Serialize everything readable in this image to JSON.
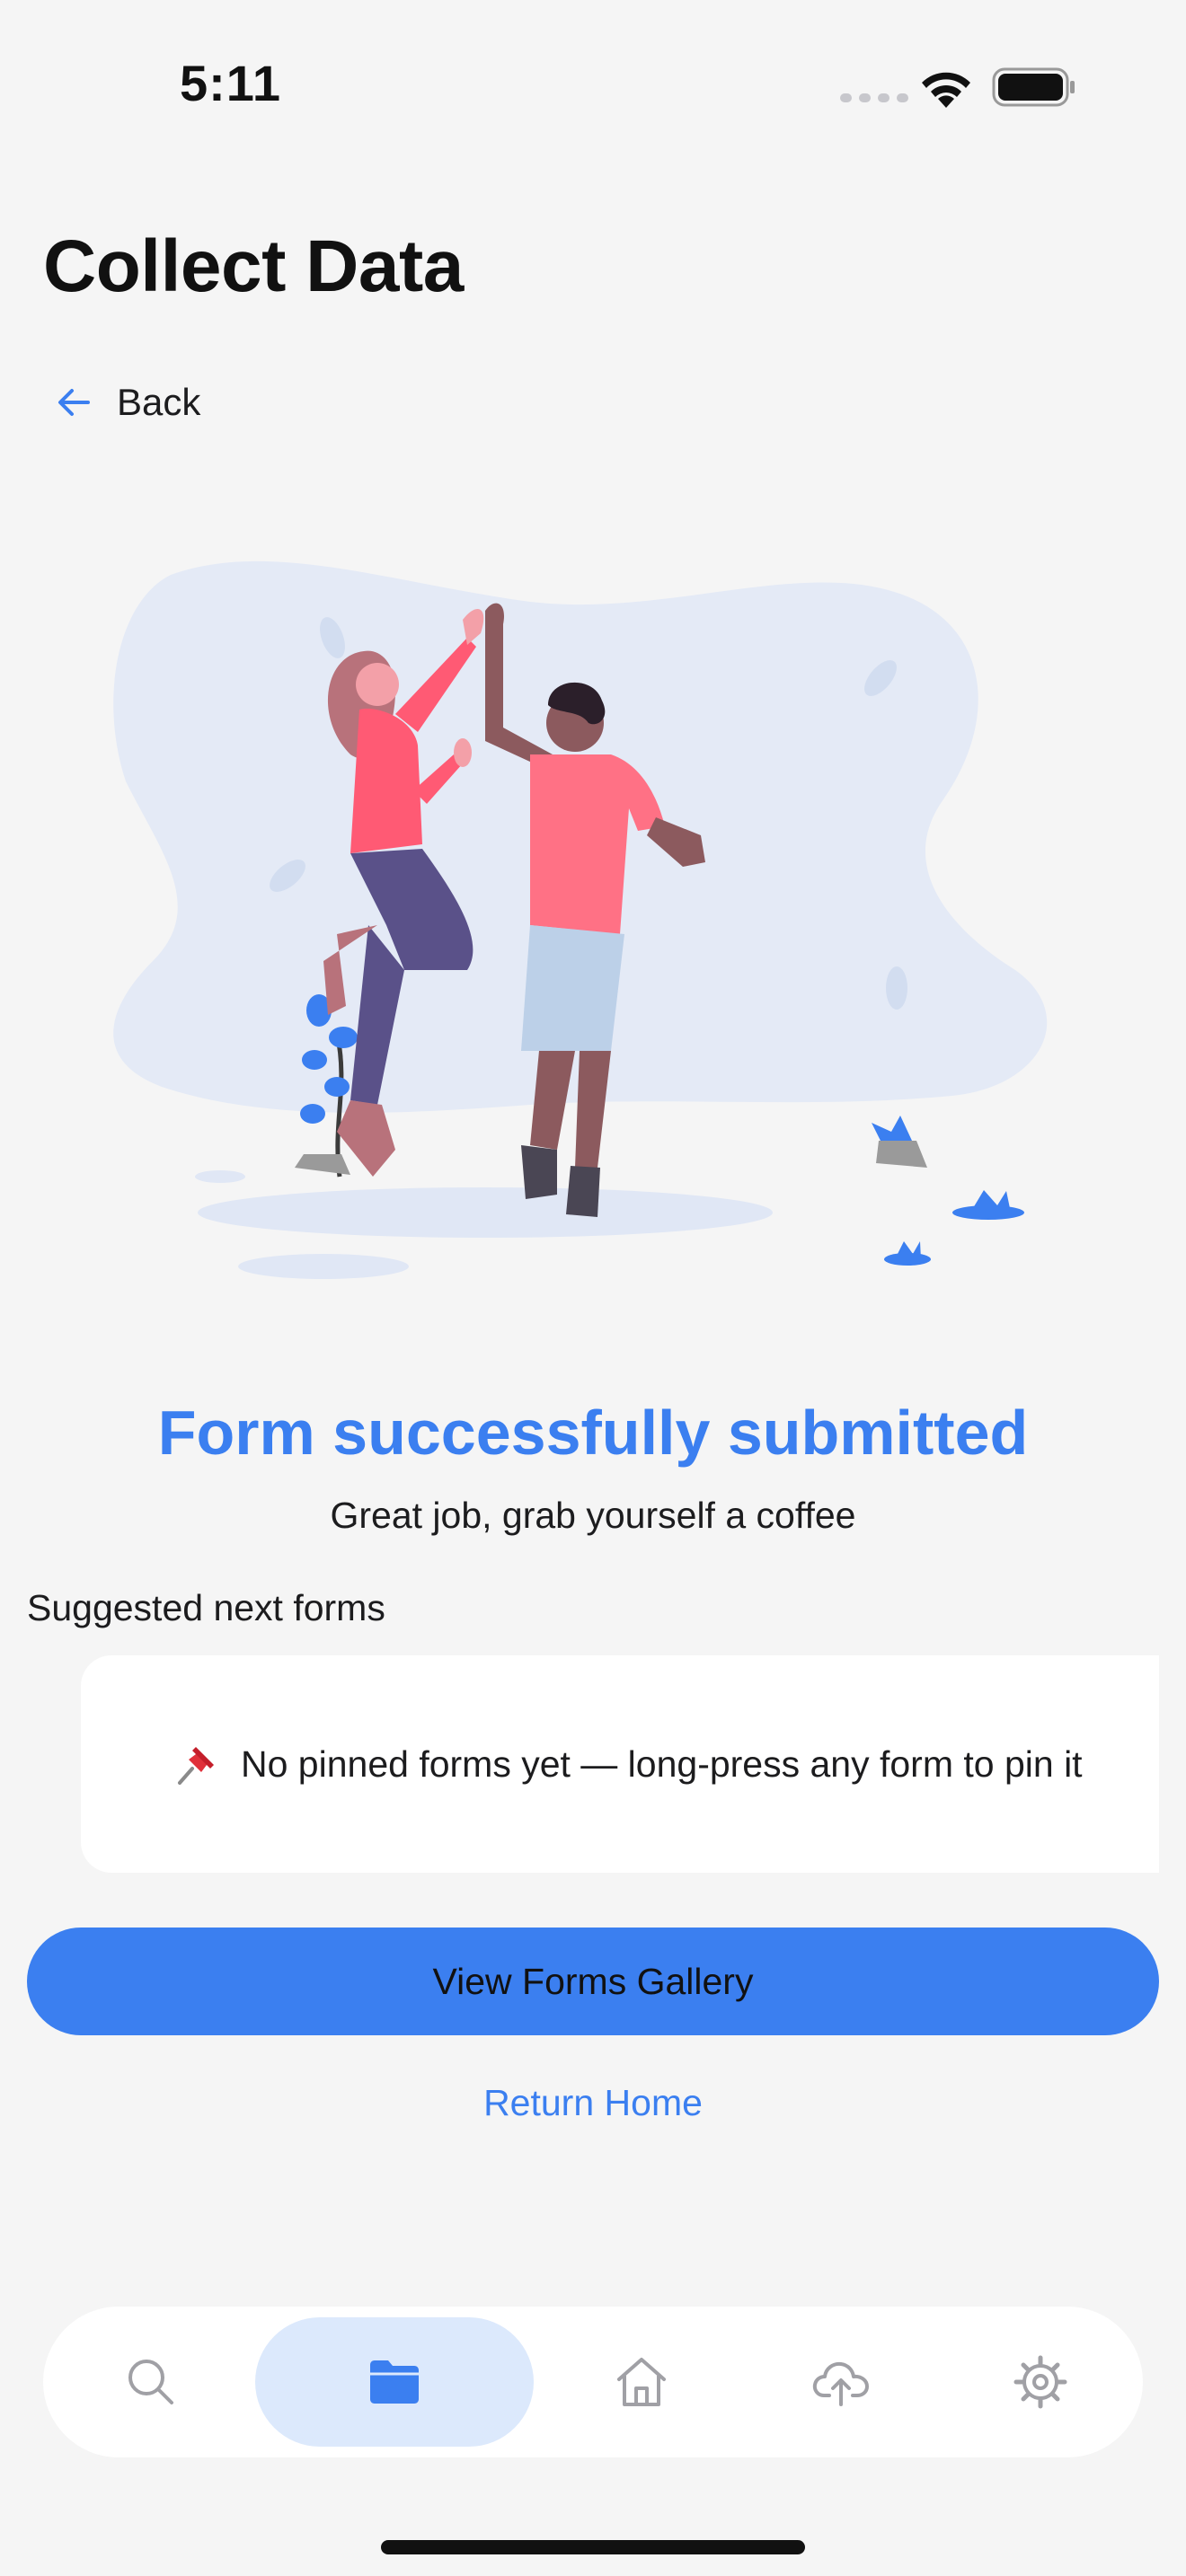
{
  "status_bar": {
    "time": "5:11"
  },
  "header": {
    "title": "Collect Data",
    "back_label": "Back"
  },
  "success": {
    "title": "Form successfully submitted",
    "subtitle": "Great job, grab yourself a coffee"
  },
  "suggested": {
    "label": "Suggested next forms",
    "empty_icon": "pushpin-icon",
    "empty_message": "No pinned forms yet — long-press any form to pin it"
  },
  "actions": {
    "primary_label": "View Forms Gallery",
    "secondary_label": "Return Home"
  },
  "tab_bar": {
    "items": [
      {
        "icon": "search-icon",
        "active": false
      },
      {
        "icon": "folder-icon",
        "active": true
      },
      {
        "icon": "home-icon",
        "active": false
      },
      {
        "icon": "cloud-upload-icon",
        "active": false
      },
      {
        "icon": "gear-icon",
        "active": false
      }
    ]
  },
  "colors": {
    "accent": "#3b7ff0",
    "background": "#f5f5f5",
    "active_tab_bg": "#dce9fc",
    "inactive_icon": "#a0a0a5"
  }
}
